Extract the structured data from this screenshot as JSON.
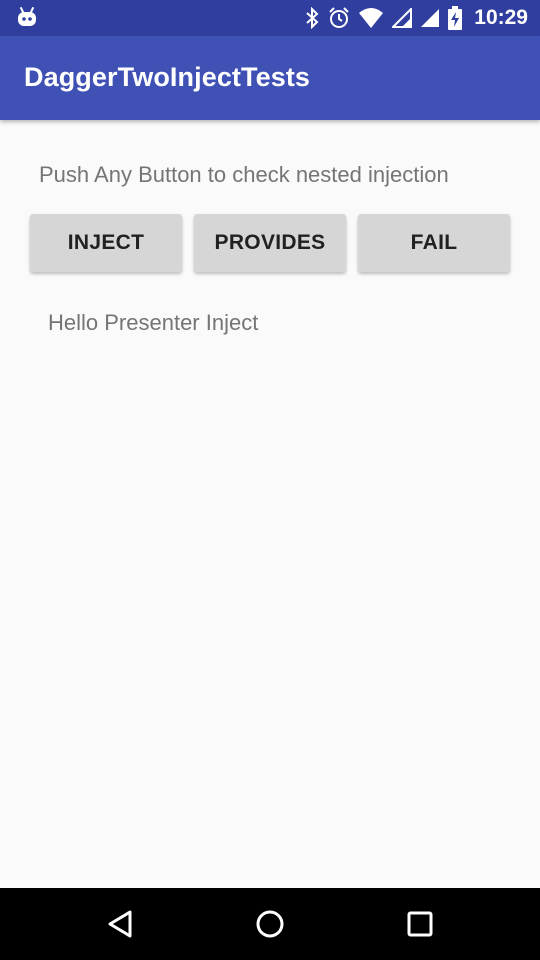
{
  "status_bar": {
    "time": "10:29",
    "icons": [
      "android-debug-icon",
      "bluetooth-icon",
      "alarm-icon",
      "wifi-icon",
      "signal-icon",
      "signal-icon",
      "battery-charging-icon"
    ]
  },
  "app_bar": {
    "title": "DaggerTwoInjectTests"
  },
  "main": {
    "instruction": "Push Any Button to check nested injection",
    "buttons": [
      {
        "label": "INJECT"
      },
      {
        "label": "PROVIDES"
      },
      {
        "label": "FAIL"
      }
    ],
    "result_text": "Hello Presenter Inject"
  },
  "nav_bar": {
    "buttons": [
      "back-icon",
      "home-icon",
      "recents-icon"
    ]
  },
  "colors": {
    "status_bar": "#303f9f",
    "app_bar": "#3f51b5",
    "background": "#fafafa",
    "button": "#d6d6d6",
    "secondary_text": "#757575"
  }
}
